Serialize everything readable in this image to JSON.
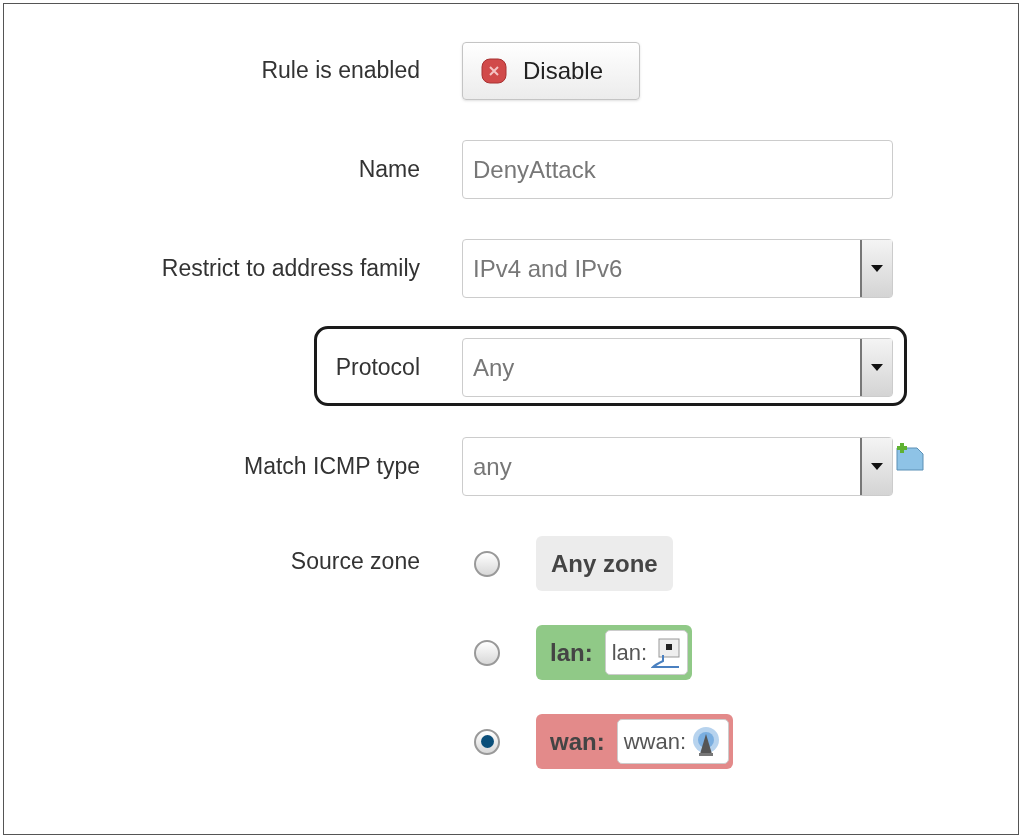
{
  "fields": [
    {
      "kind": "button",
      "label": "Rule is enabled",
      "button": "Disable"
    },
    {
      "kind": "text",
      "label": "Name",
      "value": "DenyAttack"
    },
    {
      "kind": "select",
      "label": "Restrict to address family",
      "value": "IPv4 and IPv6"
    },
    {
      "kind": "select",
      "label": "Protocol",
      "value": "Any",
      "highlighted": true
    },
    {
      "kind": "select_add",
      "label": "Match ICMP type",
      "value": "any"
    },
    {
      "kind": "zones",
      "label": "Source zone",
      "zones": [
        {
          "kind": "any",
          "name": "Any zone",
          "selected": false
        },
        {
          "kind": "lan",
          "name": "lan:",
          "color": "#90c987",
          "network": "lan:",
          "selected": false
        },
        {
          "kind": "wan",
          "name": "wan:",
          "color": "#e38a8a",
          "network": "wwan:",
          "selected": true
        }
      ]
    }
  ]
}
